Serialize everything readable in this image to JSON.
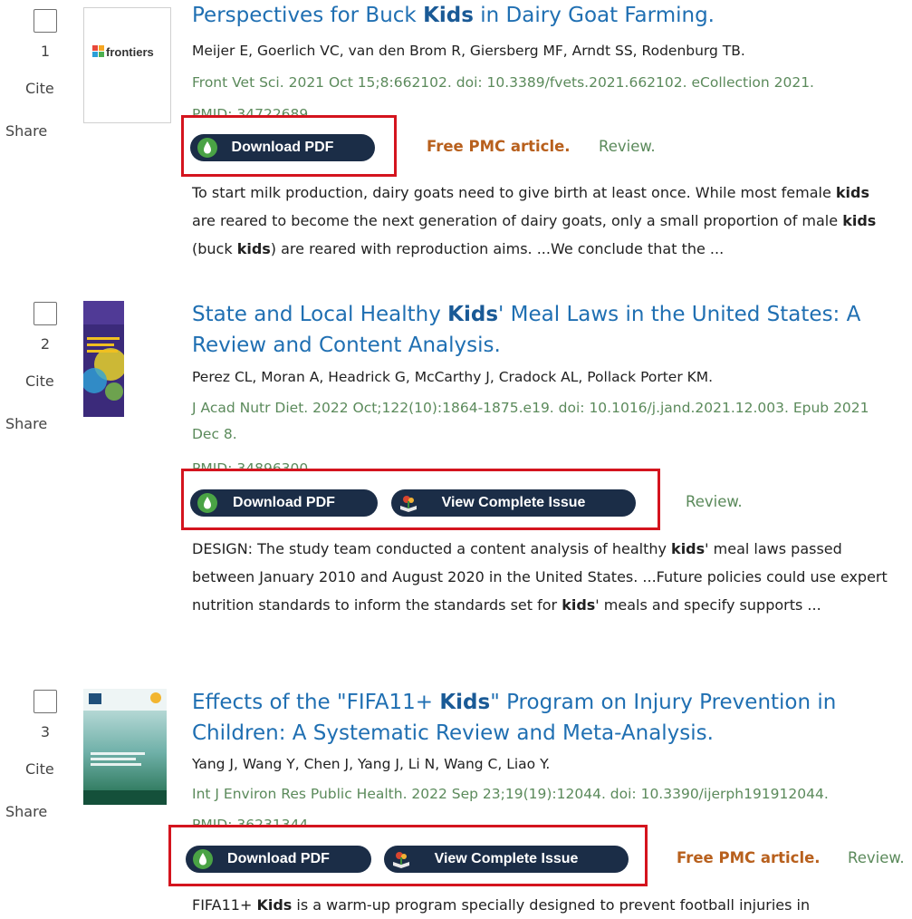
{
  "labels": {
    "cite": "Cite",
    "share": "Share"
  },
  "results": [
    {
      "number": "1",
      "thumb_brand": "frontiers",
      "title_before": "Perspectives for Buck ",
      "title_kw": "Kids",
      "title_after": " in Dairy Goat Farming.",
      "authors": "Meijer E, Goerlich VC, van den Brom R, Giersberg MF, Arndt SS, Rodenburg TB.",
      "citation": "Front Vet Sci. 2021 Oct 15;8:662102. doi: 10.3389/fvets.2021.662102. eCollection 2021.",
      "pmid": "PMID: 34722689",
      "download_pdf": "Download PDF",
      "free_pmc": "Free PMC article.",
      "review": "Review.",
      "snippet": [
        "To start milk production, dairy goats need to give birth at least once. While most female ",
        "kids",
        " are reared to become the next generation of dairy goats, only a small proportion of male ",
        "kids",
        " (buck ",
        "kids",
        ") are reared with reproduction aims. ...We conclude that the ..."
      ]
    },
    {
      "number": "2",
      "title_before": "State and Local Healthy ",
      "title_kw": "Kids",
      "title_after": "' Meal Laws in the United States: A Review and Content Analysis.",
      "authors": "Perez CL, Moran A, Headrick G, McCarthy J, Cradock AL, Pollack Porter KM.",
      "citation": "J Acad Nutr Diet. 2022 Oct;122(10):1864-1875.e19. doi: 10.1016/j.jand.2021.12.003. Epub 2021 Dec 8.",
      "pmid": "PMID: 34896300",
      "download_pdf": "Download PDF",
      "view_issue": "View Complete Issue",
      "review": "Review.",
      "snippet": [
        "DESIGN: The study team conducted a content analysis of healthy ",
        "kids",
        "' meal laws passed between January 2010 and August 2020 in the United States. ...Future policies could use expert nutrition standards to inform the standards set for ",
        "kids",
        "' meals and specify supports ..."
      ]
    },
    {
      "number": "3",
      "title_before": "Effects of the \"FIFA11+ ",
      "title_kw": "Kids",
      "title_after": "\" Program on Injury Prevention in Children: A Systematic Review and Meta-Analysis.",
      "authors": "Yang J, Wang Y, Chen J, Yang J, Li N, Wang C, Liao Y.",
      "citation": "Int J Environ Res Public Health. 2022 Sep 23;19(19):12044. doi: 10.3390/ijerph191912044.",
      "pmid": "PMID: 36231344",
      "download_pdf": "Download PDF",
      "view_issue": "View Complete Issue",
      "free_pmc": "Free PMC article.",
      "review": "Review.",
      "snippet": [
        "FIFA11+ ",
        "Kids",
        " is a warm-up program specially designed to prevent football injuries in"
      ]
    }
  ]
}
